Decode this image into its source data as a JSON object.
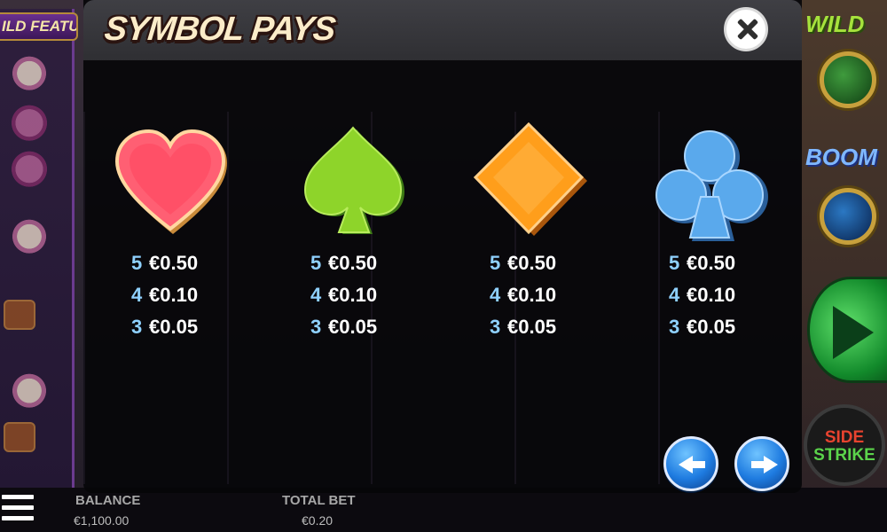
{
  "background": {
    "left_banner": "ILD FEATURE",
    "right_badges": [
      "WILD",
      "BOOM"
    ],
    "side_strike": {
      "line1": "SIDE",
      "line2": "STRIKE"
    }
  },
  "modal": {
    "title": "SYMBOL PAYS",
    "symbols": [
      {
        "name": "heart",
        "color": "#ff5a6e",
        "pays": [
          {
            "count": "5",
            "amount": "€0.50"
          },
          {
            "count": "4",
            "amount": "€0.10"
          },
          {
            "count": "3",
            "amount": "€0.05"
          }
        ]
      },
      {
        "name": "spade",
        "color": "#8ed42a",
        "pays": [
          {
            "count": "5",
            "amount": "€0.50"
          },
          {
            "count": "4",
            "amount": "€0.10"
          },
          {
            "count": "3",
            "amount": "€0.05"
          }
        ]
      },
      {
        "name": "diamond",
        "color": "#ff9e1b",
        "pays": [
          {
            "count": "5",
            "amount": "€0.50"
          },
          {
            "count": "4",
            "amount": "€0.10"
          },
          {
            "count": "3",
            "amount": "€0.05"
          }
        ]
      },
      {
        "name": "club",
        "color": "#5aa9ec",
        "pays": [
          {
            "count": "5",
            "amount": "€0.50"
          },
          {
            "count": "4",
            "amount": "€0.10"
          },
          {
            "count": "3",
            "amount": "€0.05"
          }
        ]
      }
    ]
  },
  "footer": {
    "balance_label": "BALANCE",
    "balance_value": "€1,100.00",
    "total_bet_label": "TOTAL BET",
    "total_bet_value": "€0.20"
  },
  "icons": [
    "menu-icon",
    "close-icon",
    "arrow-left-icon",
    "arrow-right-icon",
    "heart-icon",
    "spade-icon",
    "diamond-icon",
    "club-icon"
  ]
}
